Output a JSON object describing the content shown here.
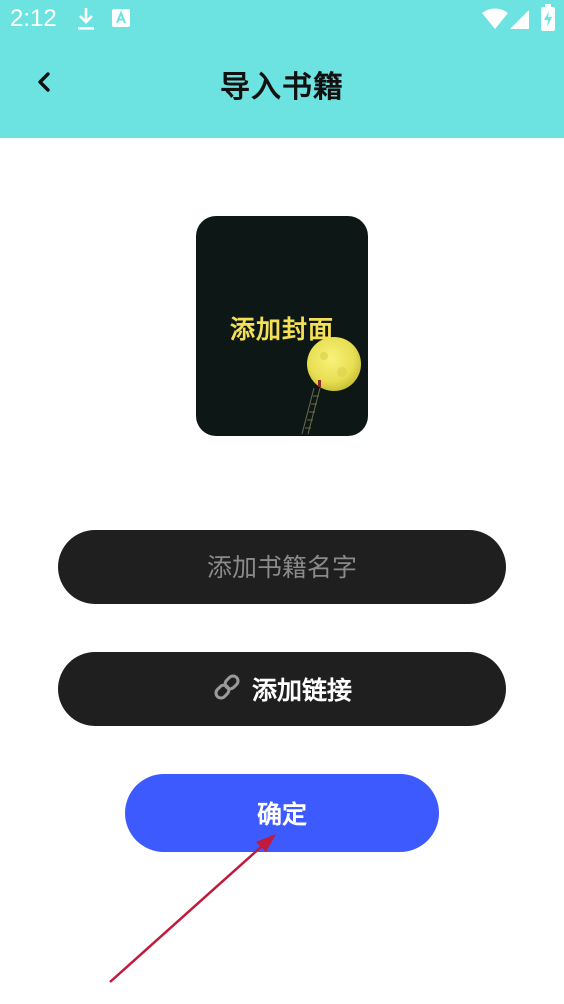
{
  "status_bar": {
    "time": "2:12",
    "icons": [
      "download-icon",
      "font-app-icon",
      "wifi-icon",
      "signal-icon",
      "battery-charging-icon"
    ]
  },
  "header": {
    "title": "导入书籍",
    "back_icon": "chevron-left-icon"
  },
  "cover": {
    "label": "添加封面"
  },
  "form": {
    "name_placeholder": "添加书籍名字",
    "name_value": "",
    "link_label": "添加链接",
    "link_icon": "link-icon",
    "confirm_label": "确定"
  },
  "colors": {
    "header_bg": "#6de3e1",
    "field_bg": "#1f1f1f",
    "confirm_bg": "#3d5afe",
    "cover_text": "#f5df56",
    "annotation_arrow": "#c01a3c"
  }
}
